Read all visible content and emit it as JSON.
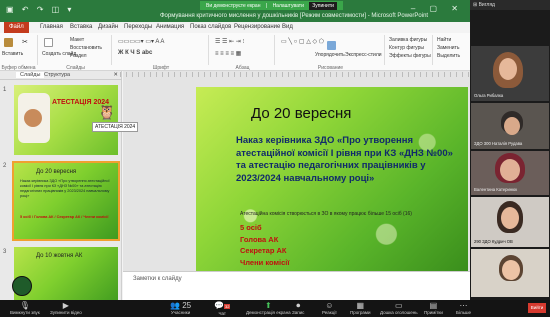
{
  "screen_share_banner": {
    "text": "Ви демонструєте екран",
    "control": "Налаштувати",
    "stop_label": "Зупинити"
  },
  "window": {
    "title": "Формування критичного мислення у дошкільників [Режим совместимости] - Microsoft PowerPoint",
    "qat": "▣ ↶ ↷ ◫ ▾"
  },
  "ribbon": {
    "file_tab": "Файл",
    "tabs": [
      "Главная",
      "Вставка",
      "Дизайн",
      "Переходы",
      "Анимация",
      "Показ слайдов",
      "Рецензирование",
      "Вид"
    ],
    "groups": [
      "Буфер обмена",
      "Слайды",
      "Шрифт",
      "Абзац",
      "Рисование"
    ],
    "buttons": {
      "paste": "Вставить",
      "create_slide": "Создать слайд",
      "layout": "Макет",
      "reset": "Восстановить",
      "section": "Раздел",
      "arrange": "Упорядочить",
      "express_styles": "Экспресс-стили",
      "fill": "Заливка фигуры",
      "outline": "Контур фигуры",
      "effects": "Эффекты фигуры",
      "find": "Найти",
      "replace": "Заменить",
      "select": "Выделить"
    }
  },
  "slides_panel": {
    "tabs": [
      "Слайды",
      "Структура"
    ],
    "tooltip": "АТЕСТАЦІЯ 2024",
    "slides": [
      {
        "num": "1",
        "title": "АТЕСТАЦІЯ  2024"
      },
      {
        "num": "2",
        "title": "До 20 вересня",
        "body": "Наказ керівника ЗДО «Про утворення атестаційної комісії І рівня при КЗ «ДНЗ №00» та атестацію педагогічних працівників у 2023/2024 навчальному році»",
        "list": "5 осіб / Голова АК / Секретар АК / Члени комісії"
      },
      {
        "num": "3",
        "title": "До 10 жовтня  АК"
      }
    ]
  },
  "slide": {
    "title": "До 20 вересня",
    "body": "Наказ керівника ЗДО «Про утворення атестаційної комісії І рівня при КЗ «ДНЗ №00» та атестацію педагогічних працівників у 2023/2024 навчальному році»",
    "note": "Атестаційна комісія створюється в ЗО в якому працює більше 15 осіб (16)",
    "list": [
      "5 осіб",
      "Голова АК",
      "Секретар АК",
      "Члени комісії"
    ]
  },
  "notes_placeholder": "Заметки к слайду",
  "gallery": {
    "header": "⊞ Вигляд",
    "participants": [
      "Ольга Рибалка",
      "ЗДО 300 Наталія Рудава",
      "Валентина Катеринюк",
      "290 ЗДО Кудрич ОВ",
      ""
    ]
  },
  "meeting_controls": {
    "items": [
      "Вимкнути звук",
      "Зупинити відео",
      "Учасники",
      "Чат",
      "Демонстрація екрана",
      "Запис",
      "Реакції",
      "Програми",
      "Дошка оголошень",
      "Примітки",
      "Більше"
    ],
    "participants_count": "25",
    "chat_badge": "32",
    "end_label": "Вийти"
  }
}
